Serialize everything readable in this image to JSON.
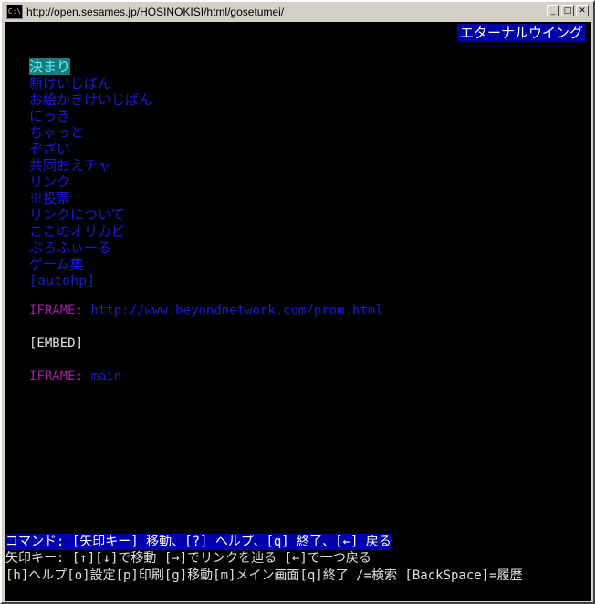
{
  "window": {
    "icon_label": "C:\\",
    "title": "http://open.sesames.jp/HOSINOKISI/html/gosetumei/",
    "buttons": [
      "_",
      "□",
      "✕"
    ]
  },
  "page": {
    "site_title": "エターナルウイング",
    "menu": [
      "決まり",
      "新けいじばん",
      "お絵かきけいじばん",
      "にっき",
      "ちゃっと",
      "ぞざい",
      "共同おえチャ",
      "リンク",
      "※投票",
      "リンクについて",
      "ここのオリカビ",
      "ぷろふぃーる",
      "ゲーム集"
    ],
    "autohp": "[autohp]",
    "iframe1_label": "IFRAME:",
    "iframe1_link": "http://www.beyondnetwork.com/prom.html",
    "embed": "[EMBED]",
    "iframe2_label": "IFRAME:",
    "iframe2_link": "main"
  },
  "status": {
    "command": "コマンド: [矢印キー] 移動、[?] ヘルプ、[q] 終了、[←] 戻る",
    "help1": "  矢印キー: [↑][↓]で移動 [→]でリンクを辿る [←]で一つ戻る",
    "help2": " [h]ヘルプ[o]設定[p]印刷[g]移動[m]メイン画面[q]終了 /=検索 [BackSpace]=履歴"
  }
}
